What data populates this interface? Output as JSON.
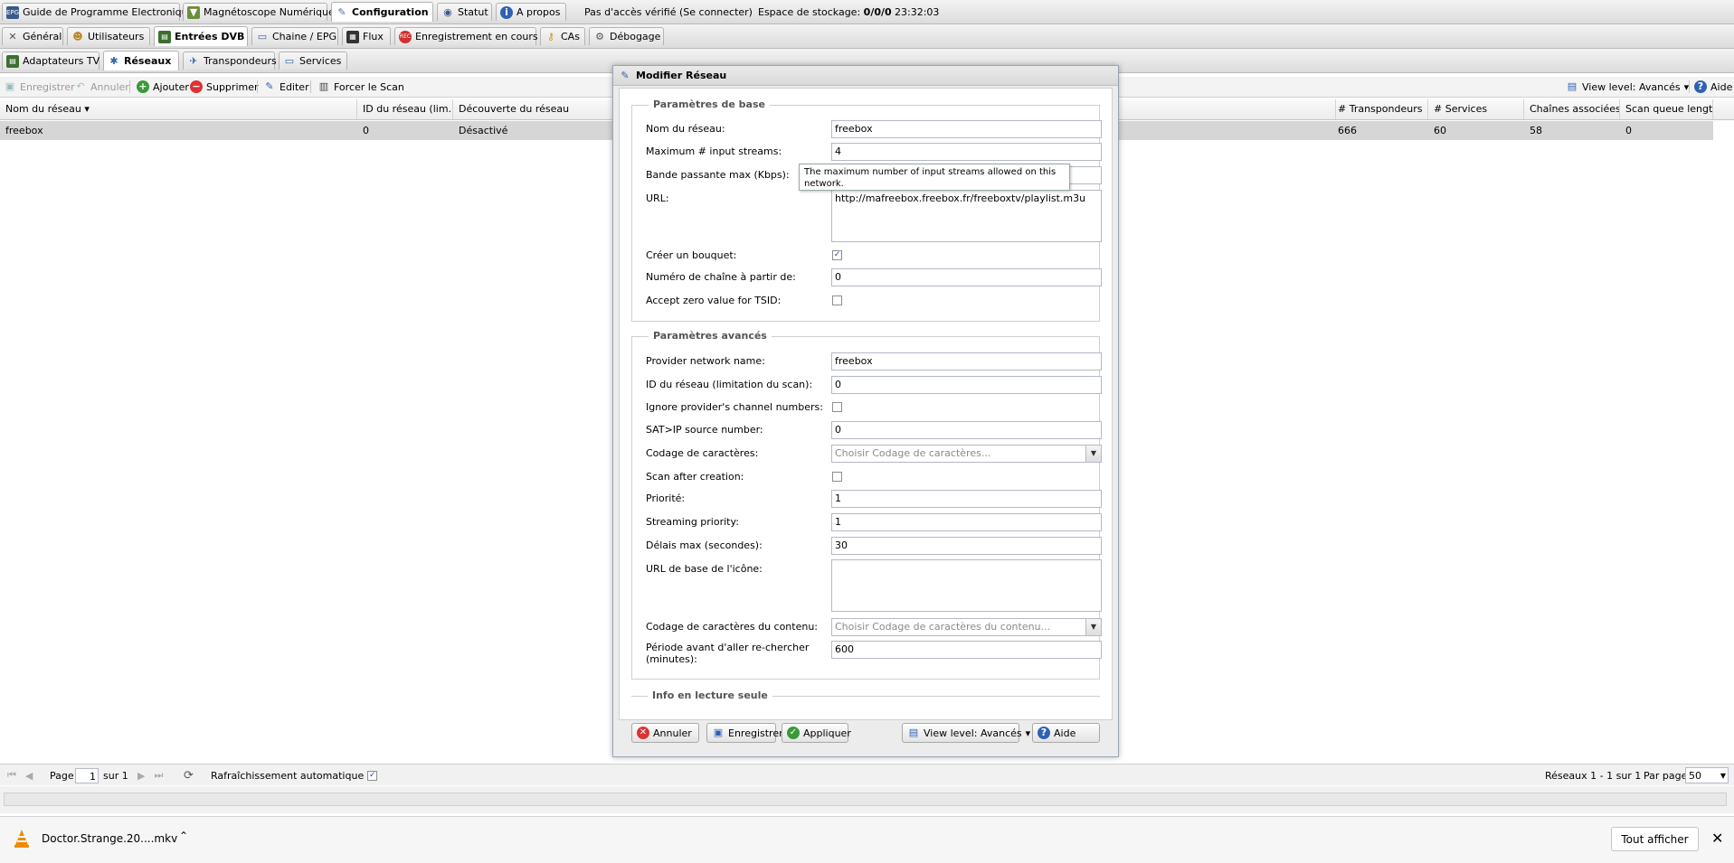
{
  "main_tabs": [
    {
      "label": "Guide de Programme Electronique",
      "icon": "epg-icon"
    },
    {
      "label": "Magnétoscope Numérique",
      "icon": "recorder-icon"
    },
    {
      "label": "Configuration",
      "icon": "wrench-icon"
    },
    {
      "label": "Statut",
      "icon": "status-icon"
    },
    {
      "label": "A propos",
      "icon": "info-icon"
    }
  ],
  "top_info": {
    "access": "Pas d'accès vérifié",
    "login": "(Se connecter)",
    "storage_label": "Espace de stockage:",
    "storage_value": "0/0/0",
    "clock": "23:32:03"
  },
  "config_tabs": [
    "Général",
    "Utilisateurs",
    "Entrées DVB",
    "Chaine / EPG",
    "Flux",
    "Enregistrement en cours",
    "CAs",
    "Débogage"
  ],
  "dvb_tabs": [
    "Adaptateurs TV",
    "Réseaux",
    "Transpondeurs",
    "Services"
  ],
  "toolbar": {
    "save": "Enregistrer",
    "cancel": "Annuler",
    "add": "Ajouter",
    "delete": "Supprimer",
    "edit": "Editer",
    "force_scan": "Forcer le Scan",
    "view_level": "View level: Avancés",
    "help": "Aide"
  },
  "grid": {
    "columns": [
      "Nom du réseau",
      "ID du réseau (lim...",
      "Découverte du réseau",
      "# Transpondeurs",
      "# Services",
      "Chaînes associées",
      "Scan queue length"
    ],
    "rows": [
      {
        "name": "freebox",
        "id": "0",
        "discovery": "Désactivé",
        "transponders": "666",
        "services": "60",
        "channels": "58",
        "scan_queue": "0"
      }
    ]
  },
  "dialog": {
    "title": "Modifier Réseau",
    "basic_legend": "Paramètres de base",
    "advanced_legend": "Paramètres avancés",
    "readonly_legend": "Info en lecture seule",
    "fields": {
      "network_name": {
        "label": "Nom du réseau:",
        "value": "freebox"
      },
      "max_input_streams": {
        "label": "Maximum # input streams:",
        "value": "4"
      },
      "max_bandwidth": {
        "label": "Bande passante max (Kbps):",
        "value": ""
      },
      "url": {
        "label": "URL:",
        "value": "http://mafreebox.freebox.fr/freeboxtv/playlist.m3u"
      },
      "create_bouquet": {
        "label": "Créer un bouquet:",
        "checked": true
      },
      "channel_number_from": {
        "label": "Numéro de chaîne à partir de:",
        "value": "0"
      },
      "accept_zero_tsid": {
        "label": "Accept zero value for TSID:",
        "checked": false
      },
      "provider_network_name": {
        "label": "Provider network name:",
        "value": "freebox"
      },
      "network_id": {
        "label": "ID du réseau (limitation du scan):",
        "value": "0"
      },
      "ignore_provider_numbers": {
        "label": "Ignore provider's channel numbers:",
        "checked": false
      },
      "satip_source": {
        "label": "SAT>IP source number:",
        "value": "0"
      },
      "charset": {
        "label": "Codage de caractères:",
        "placeholder": "Choisir Codage de caractères..."
      },
      "scan_after_creation": {
        "label": "Scan after creation:",
        "checked": false
      },
      "priority": {
        "label": "Priorité:",
        "value": "1"
      },
      "streaming_priority": {
        "label": "Streaming priority:",
        "value": "1"
      },
      "max_timeout": {
        "label": "Délais max (secondes):",
        "value": "30"
      },
      "icon_base_url": {
        "label": "URL de base de l'icône:",
        "value": ""
      },
      "content_charset": {
        "label": "Codage de caractères du contenu:",
        "placeholder": "Choisir Codage de caractères du contenu..."
      },
      "rescan_period": {
        "label": "Période avant d'aller re-chercher (minutes):",
        "value": "600"
      }
    },
    "tooltip": "The maximum number of input streams allowed on this network.",
    "buttons": {
      "cancel": "Annuler",
      "save": "Enregistrer",
      "apply": "Appliquer",
      "view_level": "View level: Avancés",
      "help": "Aide"
    }
  },
  "pager": {
    "page_label": "Page",
    "page_value": "1",
    "of_label": "sur 1",
    "auto_refresh": "Rafraîchissement automatique",
    "summary": "Réseaux 1 - 1 sur 1",
    "per_page_label": "Par page",
    "per_page_value": "50"
  },
  "downloads": {
    "file": "Doctor.Strange.20....mkv",
    "show_all": "Tout afficher"
  }
}
